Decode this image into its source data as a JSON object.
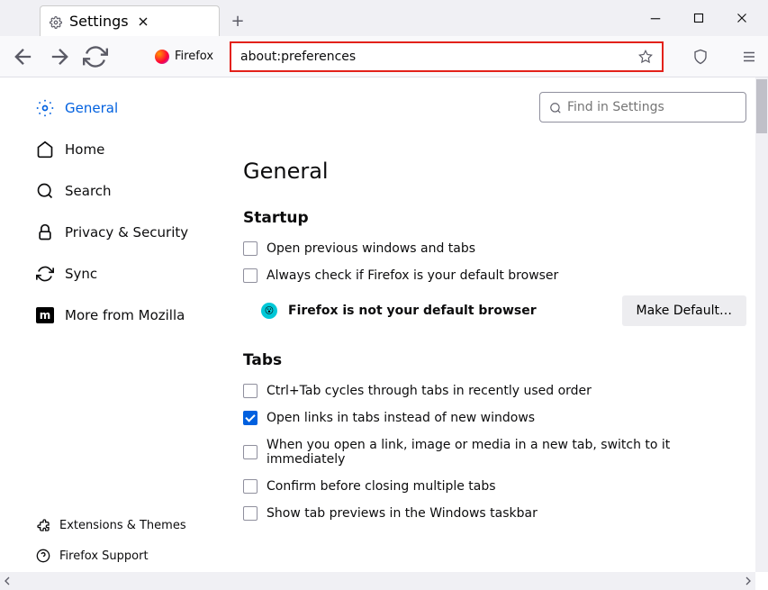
{
  "tab": {
    "title": "Settings"
  },
  "urlbar": {
    "identity": "Firefox",
    "url": "about:preferences"
  },
  "search": {
    "placeholder": "Find in Settings"
  },
  "sidebar": {
    "items": [
      {
        "label": "General"
      },
      {
        "label": "Home"
      },
      {
        "label": "Search"
      },
      {
        "label": "Privacy & Security"
      },
      {
        "label": "Sync"
      },
      {
        "label": "More from Mozilla"
      }
    ],
    "footer": [
      {
        "label": "Extensions & Themes"
      },
      {
        "label": "Firefox Support"
      }
    ]
  },
  "page": {
    "title": "General",
    "startup": {
      "heading": "Startup",
      "open_prev": "Open previous windows and tabs",
      "always_check": "Always check if Firefox is your default browser",
      "not_default": "Firefox is not your default browser",
      "make_default": "Make Default…"
    },
    "tabs": {
      "heading": "Tabs",
      "ctrl_tab": "Ctrl+Tab cycles through tabs in recently used order",
      "open_links": "Open links in tabs instead of new windows",
      "switch_immediately": "When you open a link, image or media in a new tab, switch to it immediately",
      "confirm_close": "Confirm before closing multiple tabs",
      "taskbar_previews": "Show tab previews in the Windows taskbar"
    }
  }
}
